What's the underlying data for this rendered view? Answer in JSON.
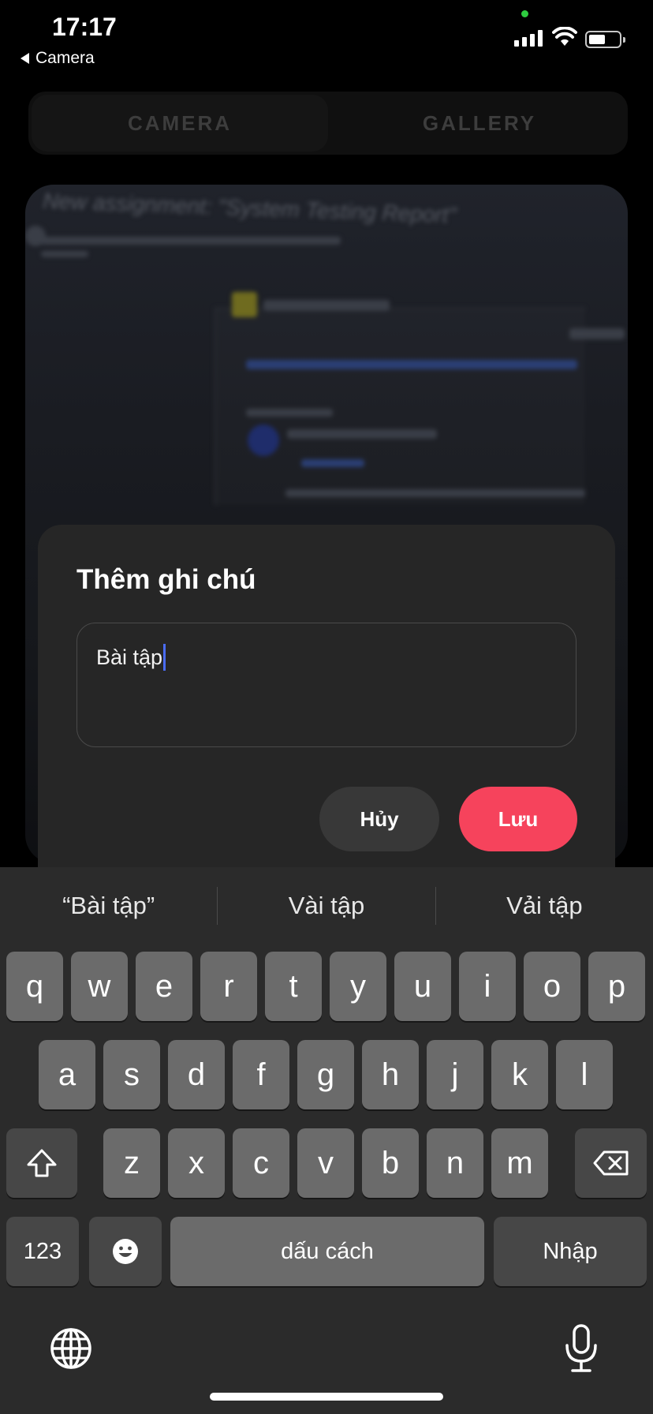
{
  "status_bar": {
    "time": "17:17",
    "back_label": "Camera"
  },
  "tabs": [
    {
      "label": "CAMERA",
      "active": true
    },
    {
      "label": "GALLERY",
      "active": false
    }
  ],
  "photo": {
    "blurred_title": "New assignment: \"System Testing Report\""
  },
  "dialog": {
    "title": "Thêm ghi chú",
    "note_value": "Bài tập",
    "cancel_label": "Hủy",
    "save_label": "Lưu",
    "save_color": "#f6435c"
  },
  "keyboard": {
    "suggestions": [
      "“Bài tập”",
      "Vài tập",
      "Vải tập"
    ],
    "row1": [
      "q",
      "w",
      "e",
      "r",
      "t",
      "y",
      "u",
      "i",
      "o",
      "p"
    ],
    "row2": [
      "a",
      "s",
      "d",
      "f",
      "g",
      "h",
      "j",
      "k",
      "l"
    ],
    "row3": [
      "z",
      "x",
      "c",
      "v",
      "b",
      "n",
      "m"
    ],
    "numbers_label": "123",
    "space_label": "dấu cách",
    "return_label": "Nhập"
  }
}
